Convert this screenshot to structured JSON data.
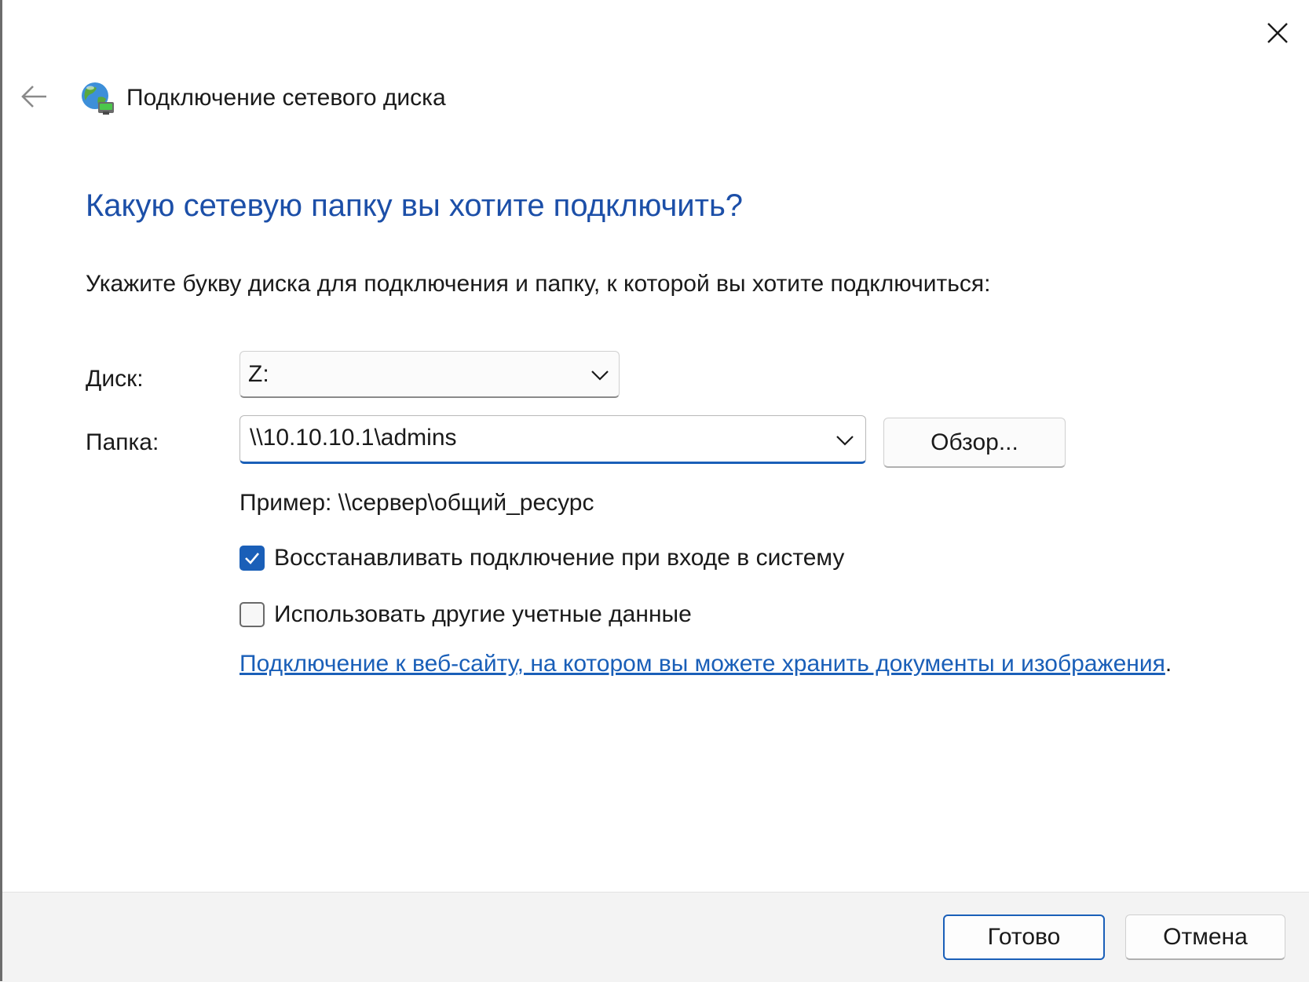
{
  "window": {
    "title": "Подключение сетевого диска",
    "icons": {
      "back": "arrow-left-icon",
      "app": "network-drive-icon",
      "close": "close-icon"
    }
  },
  "main": {
    "heading": "Какую сетевую папку вы хотите подключить?",
    "instruction": "Укажите букву диска для подключения и папку, к которой вы хотите подключиться:",
    "drive": {
      "label": "Диск:",
      "value": "Z:"
    },
    "folder": {
      "label": "Папка:",
      "value": "\\\\10.10.10.1\\admins"
    },
    "browse_label": "Обзор...",
    "example": "Пример: \\\\сервер\\общий_ресурс",
    "reconnect": {
      "label": "Восстанавливать подключение при входе в систему",
      "checked": true
    },
    "other_credentials": {
      "label": "Использовать другие учетные данные",
      "checked": false
    },
    "web_link": {
      "text": "Подключение к веб-сайту, на котором вы можете хранить документы и изображения",
      "suffix": "."
    }
  },
  "footer": {
    "finish_label": "Готово",
    "cancel_label": "Отмена"
  },
  "colors": {
    "accent": "#1a5fb8",
    "heading": "#1c4fa8",
    "footer_bg": "#f3f3f3"
  }
}
